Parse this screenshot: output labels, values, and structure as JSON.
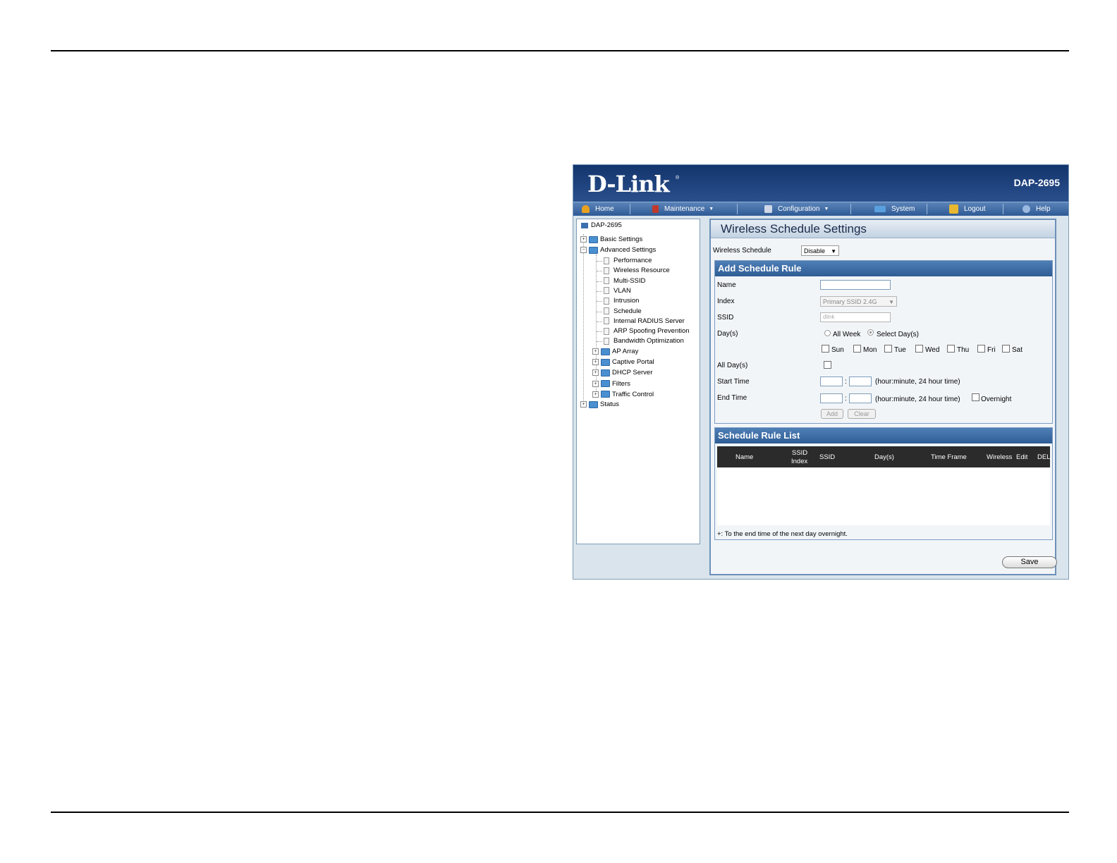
{
  "banner": {
    "logo": "D-Link",
    "registered": "®",
    "model": "DAP-2695"
  },
  "nav": [
    {
      "label": "Home",
      "icon": "home-icon",
      "color": "#e8a020",
      "dropdown": false
    },
    {
      "label": "Maintenance",
      "icon": "tools-icon",
      "color": "#c0392b",
      "dropdown": true
    },
    {
      "label": "Configuration",
      "icon": "save-disk-icon",
      "color": "#d0d8e8",
      "dropdown": true
    },
    {
      "label": "System",
      "icon": "system-icon",
      "color": "#5aa0e0",
      "dropdown": false
    },
    {
      "label": "Logout",
      "icon": "logout-icon",
      "color": "#e8b830",
      "dropdown": false
    },
    {
      "label": "Help",
      "icon": "help-icon",
      "color": "#9ab8e0",
      "dropdown": false
    }
  ],
  "tree": {
    "root": "DAP-2695",
    "basic": "Basic Settings",
    "advanced": "Advanced Settings",
    "advanced_items": [
      "Performance",
      "Wireless Resource",
      "Multi-SSID",
      "VLAN",
      "Intrusion",
      "Schedule",
      "Internal RADIUS Server",
      "ARP Spoofing Prevention",
      "Bandwidth Optimization"
    ],
    "advanced_folders": [
      "AP Array",
      "Captive Portal",
      "DHCP Server",
      "Filters",
      "Traffic Control"
    ],
    "status": "Status"
  },
  "page": {
    "title": "Wireless Schedule Settings",
    "schedule_label": "Wireless Schedule",
    "schedule_value": "Disable"
  },
  "add_rule": {
    "title": "Add Schedule Rule",
    "name_label": "Name",
    "index_label": "Index",
    "index_value": "Primary SSID 2.4G",
    "ssid_label": "SSID",
    "ssid_value": "dlink",
    "days_label": "Day(s)",
    "all_week": "All Week",
    "select_days": "Select Day(s)",
    "days": [
      "Sun",
      "Mon",
      "Tue",
      "Wed",
      "Thu",
      "Fri",
      "Sat"
    ],
    "all_days_label": "All Day(s)",
    "start_label": "Start Time",
    "end_label": "End Time",
    "time_sep": ":",
    "time_hint": "(hour:minute, 24 hour time)",
    "overnight": "Overnight",
    "add_btn": "Add",
    "clear_btn": "Clear"
  },
  "rule_list": {
    "title": "Schedule Rule List",
    "columns": {
      "name": "Name",
      "ssid_index_1": "SSID",
      "ssid_index_2": "Index",
      "ssid": "SSID",
      "days": "Day(s)",
      "time_frame": "Time Frame",
      "wireless": "Wireless",
      "edit": "Edit",
      "del": "DEL"
    },
    "footnote": "+: To the end time of the next day overnight."
  },
  "save_btn": "Save"
}
